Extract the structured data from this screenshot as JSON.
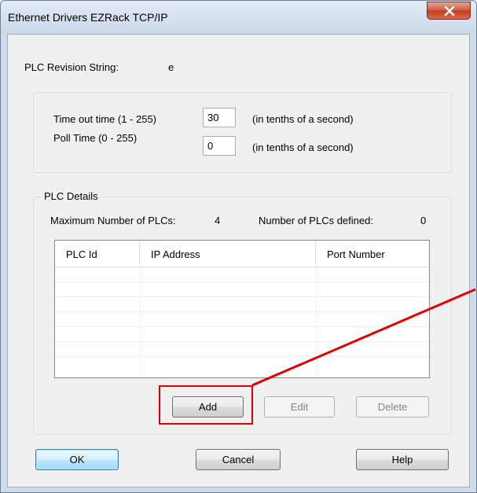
{
  "window": {
    "title": "Ethernet Drivers EZRack TCP/IP"
  },
  "revision": {
    "label": "PLC Revision String:",
    "value": "e"
  },
  "timing": {
    "timeout_label": "Time out time (1 - 255)",
    "timeout_value": "30",
    "timeout_unit": "(in tenths of a second)",
    "poll_label": "Poll Time (0 - 255)",
    "poll_value": "0",
    "poll_unit": "(in tenths of a second)"
  },
  "plc_details": {
    "caption": "PLC Details",
    "max_label": "Maximum Number of PLCs:",
    "max_value": "4",
    "defined_label": "Number of PLCs defined:",
    "defined_value": "0",
    "columns": [
      "PLC Id",
      "IP Address",
      "Port Number"
    ],
    "add_label": "Add",
    "edit_label": "Edit",
    "delete_label": "Delete"
  },
  "footer": {
    "ok_label": "OK",
    "cancel_label": "Cancel",
    "help_label": "Help"
  },
  "colors": {
    "annotation": "#e00000",
    "title_bar": "#cad8e9",
    "close_button": "#c23a1d"
  },
  "icons": {
    "close": "close-icon"
  }
}
